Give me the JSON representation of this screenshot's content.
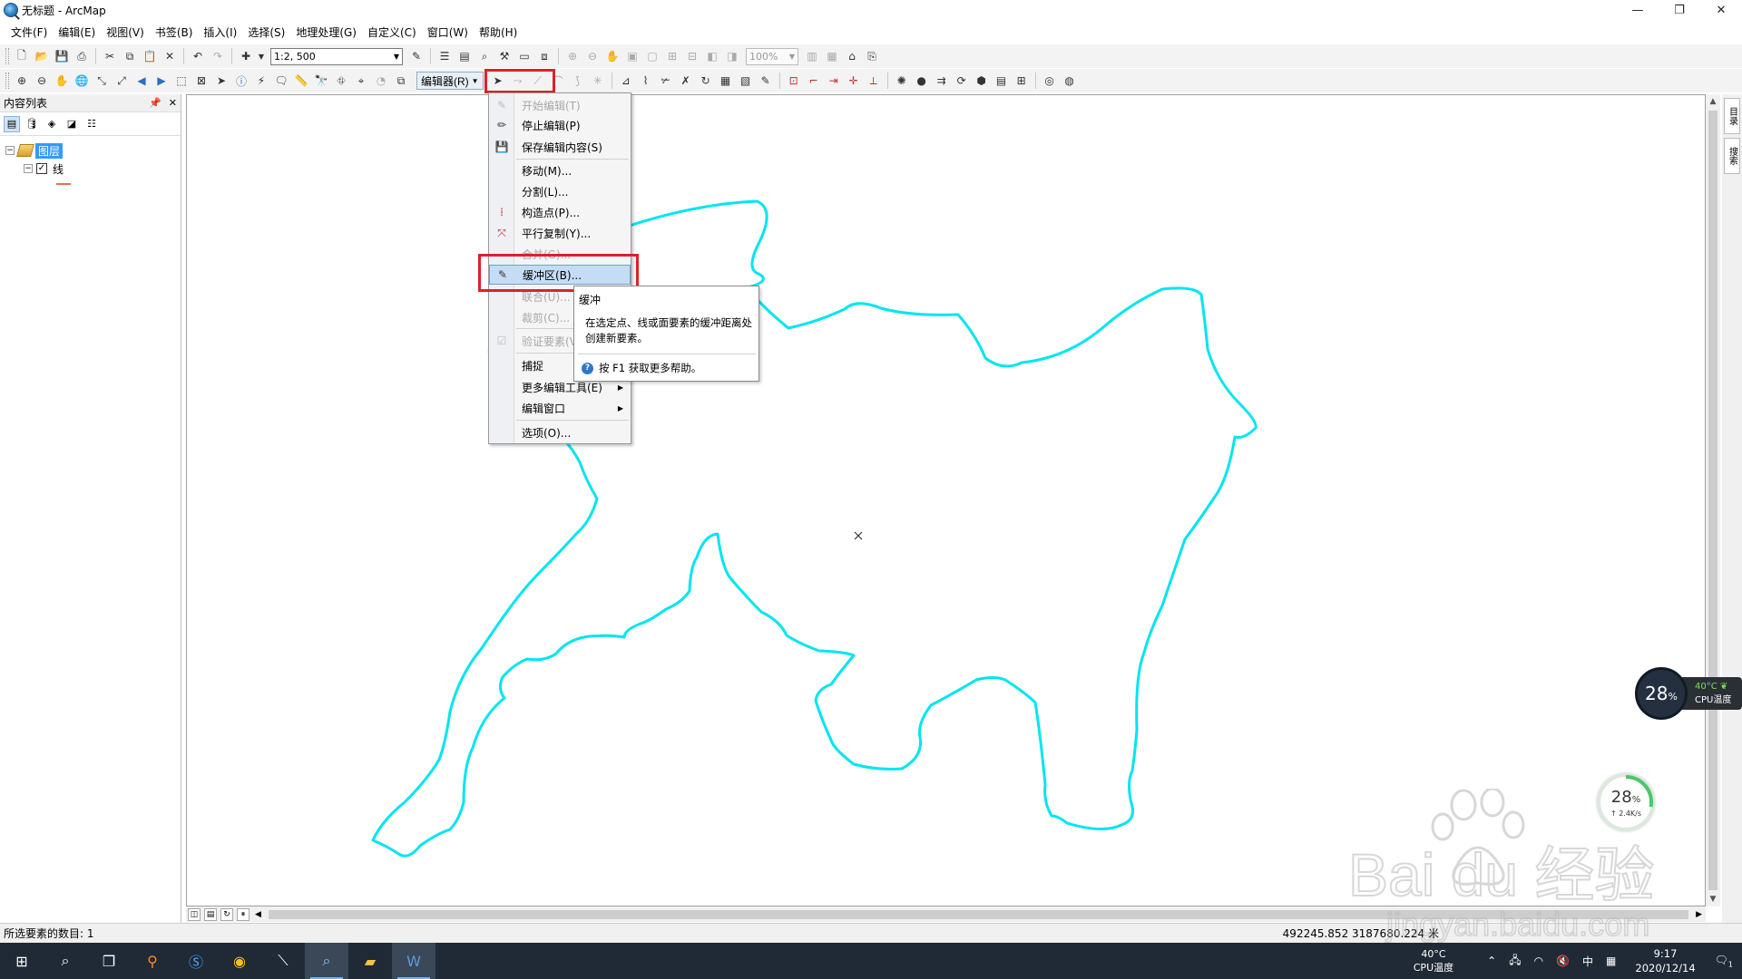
{
  "window": {
    "title": "无标题 - ArcMap",
    "controls": [
      "—",
      "❐",
      "✕"
    ]
  },
  "menubar": [
    "文件(F)",
    "编辑(E)",
    "视图(V)",
    "书签(B)",
    "插入(I)",
    "选择(S)",
    "地理处理(G)",
    "自定义(C)",
    "窗口(W)",
    "帮助(H)"
  ],
  "toolbar": {
    "scale": "1:2, 500",
    "zoom": "100%",
    "editor_label": "编辑器(R)"
  },
  "toc": {
    "title": "内容列表",
    "dataframe": "图层",
    "layer": "线"
  },
  "editor_menu": {
    "items": [
      {
        "label": "开始编辑(T)",
        "disabled": true,
        "icon": "pencil-icon"
      },
      {
        "label": "停止编辑(P)",
        "disabled": false,
        "icon": "stop-edit-icon"
      },
      {
        "label": "保存编辑内容(S)",
        "disabled": false,
        "icon": "save-edits-icon"
      },
      {
        "label": "移动(M)...",
        "disabled": false
      },
      {
        "label": "分割(L)...",
        "disabled": false
      },
      {
        "label": "构造点(P)...",
        "disabled": false,
        "icon": "construct-points-icon"
      },
      {
        "label": "平行复制(Y)...",
        "disabled": false,
        "icon": "copy-parallel-icon"
      },
      {
        "label": "合并(G)...",
        "disabled": true
      },
      {
        "label": "缓冲区(B)...",
        "disabled": false,
        "highlighted": true,
        "icon": "buffer-icon"
      },
      {
        "label": "联合(U)...",
        "disabled": true
      },
      {
        "label": "裁剪(C)...",
        "disabled": true
      },
      {
        "label": "验证要素(V)",
        "disabled": true,
        "icon": "validate-icon"
      },
      {
        "label": "捕捉",
        "disabled": false,
        "submenu": true
      },
      {
        "label": "更多编辑工具(E)",
        "disabled": false,
        "submenu": true
      },
      {
        "label": "编辑窗口",
        "disabled": false,
        "submenu": true
      },
      {
        "label": "选项(O)...",
        "disabled": false
      }
    ]
  },
  "tooltip": {
    "title": "缓冲",
    "description": "在选定点、线或面要素的缓冲距离处创建新要素。",
    "help": "按 F1 获取更多帮助。"
  },
  "right_strip": [
    "目录",
    "搜索"
  ],
  "status": {
    "left": "所选要素的数目: 1",
    "coords": "492245.852  3187680.224 米"
  },
  "widgets": {
    "cpu_percent": "28",
    "cpu_temp": "40°C",
    "cpu_label": "CPU温度",
    "net_percent": "28",
    "net_speed": "↑ 2.4K/s",
    "percent_sign": "%"
  },
  "watermark": {
    "brand": "Bai du 经验",
    "url": "jingyan.baidu.com"
  },
  "taskbar": {
    "tray_temp": "40°C",
    "tray_temp_label": "CPU温度",
    "ime": "中",
    "time": "9:17",
    "date": "2020/12/14",
    "notification_count": "1"
  },
  "colors": {
    "feature_line": "#00e5f0",
    "highlight_box": "#e0202a"
  }
}
